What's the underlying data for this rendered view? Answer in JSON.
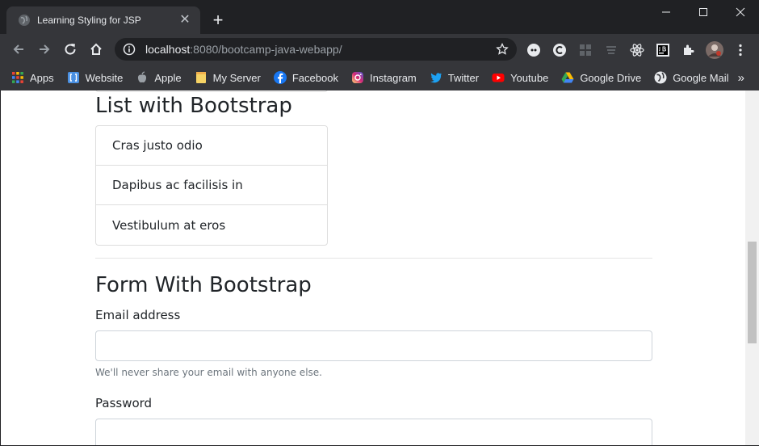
{
  "tab": {
    "title": "Learning Styling for JSP",
    "close": "✕",
    "new_tab": "+"
  },
  "address": {
    "host": "localhost",
    "rest": ":8080/bootcamp-java-webapp/"
  },
  "bookmarks": [
    {
      "label": "Apps",
      "icon": "apps-grid-icon"
    },
    {
      "label": "Website",
      "icon": "website-icon"
    },
    {
      "label": "Apple",
      "icon": "apple-icon"
    },
    {
      "label": "My Server",
      "icon": "folder-icon"
    },
    {
      "label": "Facebook",
      "icon": "facebook-icon"
    },
    {
      "label": "Instagram",
      "icon": "instagram-icon"
    },
    {
      "label": "Twitter",
      "icon": "twitter-icon"
    },
    {
      "label": "Youtube",
      "icon": "youtube-icon"
    },
    {
      "label": "Google Drive",
      "icon": "google-drive-icon"
    },
    {
      "label": "Google Mail",
      "icon": "globe-icon"
    }
  ],
  "bookmarks_more": "»",
  "page": {
    "list_heading": "List with Bootstrap",
    "list_items": [
      "Cras justo odio",
      "Dapibus ac facilisis in",
      "Vestibulum at eros"
    ],
    "form_heading": "Form With Bootstrap",
    "email_label": "Email address",
    "email_help": "We'll never share your email with anyone else.",
    "password_label": "Password"
  },
  "colors": {
    "chrome_dark": "#202124",
    "chrome_toolbar": "#35363a",
    "text_light": "#e8eaed"
  }
}
